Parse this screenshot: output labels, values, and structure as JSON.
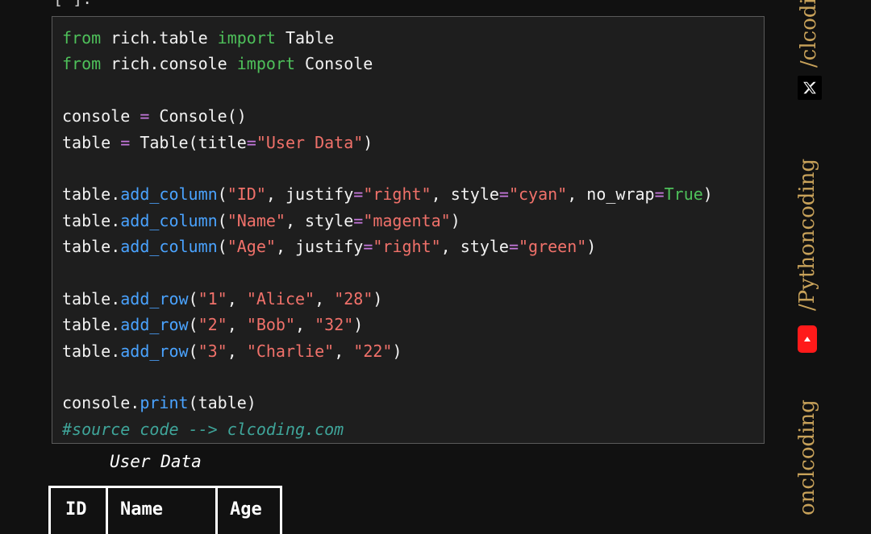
{
  "cell": {
    "prompt": "[*]:"
  },
  "code_lines": [
    [
      {
        "t": "kw",
        "v": "from"
      },
      {
        "t": "",
        "v": " rich.table "
      },
      {
        "t": "kw",
        "v": "import"
      },
      {
        "t": "",
        "v": " Table"
      }
    ],
    [
      {
        "t": "kw",
        "v": "from"
      },
      {
        "t": "",
        "v": " rich.console "
      },
      {
        "t": "kw",
        "v": "import"
      },
      {
        "t": "",
        "v": " Console"
      }
    ],
    [],
    [
      {
        "t": "",
        "v": "console "
      },
      {
        "t": "op",
        "v": "="
      },
      {
        "t": "",
        "v": " Console()"
      }
    ],
    [
      {
        "t": "",
        "v": "table "
      },
      {
        "t": "op",
        "v": "="
      },
      {
        "t": "",
        "v": " Table(title"
      },
      {
        "t": "op",
        "v": "="
      },
      {
        "t": "str",
        "v": "\"User Data\""
      },
      {
        "t": "",
        "v": ")"
      }
    ],
    [],
    [
      {
        "t": "",
        "v": "table."
      },
      {
        "t": "fn",
        "v": "add_column"
      },
      {
        "t": "",
        "v": "("
      },
      {
        "t": "str",
        "v": "\"ID\""
      },
      {
        "t": "",
        "v": ", justify"
      },
      {
        "t": "op",
        "v": "="
      },
      {
        "t": "str",
        "v": "\"right\""
      },
      {
        "t": "",
        "v": ", style"
      },
      {
        "t": "op",
        "v": "="
      },
      {
        "t": "str",
        "v": "\"cyan\""
      },
      {
        "t": "",
        "v": ", no_wrap"
      },
      {
        "t": "op",
        "v": "="
      },
      {
        "t": "bool",
        "v": "True"
      },
      {
        "t": "",
        "v": ")"
      }
    ],
    [
      {
        "t": "",
        "v": "table."
      },
      {
        "t": "fn",
        "v": "add_column"
      },
      {
        "t": "",
        "v": "("
      },
      {
        "t": "str",
        "v": "\"Name\""
      },
      {
        "t": "",
        "v": ", style"
      },
      {
        "t": "op",
        "v": "="
      },
      {
        "t": "str",
        "v": "\"magenta\""
      },
      {
        "t": "",
        "v": ")"
      }
    ],
    [
      {
        "t": "",
        "v": "table."
      },
      {
        "t": "fn",
        "v": "add_column"
      },
      {
        "t": "",
        "v": "("
      },
      {
        "t": "str",
        "v": "\"Age\""
      },
      {
        "t": "",
        "v": ", justify"
      },
      {
        "t": "op",
        "v": "="
      },
      {
        "t": "str",
        "v": "\"right\""
      },
      {
        "t": "",
        "v": ", style"
      },
      {
        "t": "op",
        "v": "="
      },
      {
        "t": "str",
        "v": "\"green\""
      },
      {
        "t": "",
        "v": ")"
      }
    ],
    [],
    [
      {
        "t": "",
        "v": "table."
      },
      {
        "t": "fn",
        "v": "add_row"
      },
      {
        "t": "",
        "v": "("
      },
      {
        "t": "str",
        "v": "\"1\""
      },
      {
        "t": "",
        "v": ", "
      },
      {
        "t": "str",
        "v": "\"Alice\""
      },
      {
        "t": "",
        "v": ", "
      },
      {
        "t": "str",
        "v": "\"28\""
      },
      {
        "t": "",
        "v": ")"
      }
    ],
    [
      {
        "t": "",
        "v": "table."
      },
      {
        "t": "fn",
        "v": "add_row"
      },
      {
        "t": "",
        "v": "("
      },
      {
        "t": "str",
        "v": "\"2\""
      },
      {
        "t": "",
        "v": ", "
      },
      {
        "t": "str",
        "v": "\"Bob\""
      },
      {
        "t": "",
        "v": ", "
      },
      {
        "t": "str",
        "v": "\"32\""
      },
      {
        "t": "",
        "v": ")"
      }
    ],
    [
      {
        "t": "",
        "v": "table."
      },
      {
        "t": "fn",
        "v": "add_row"
      },
      {
        "t": "",
        "v": "("
      },
      {
        "t": "str",
        "v": "\"3\""
      },
      {
        "t": "",
        "v": ", "
      },
      {
        "t": "str",
        "v": "\"Charlie\""
      },
      {
        "t": "",
        "v": ", "
      },
      {
        "t": "str",
        "v": "\"22\""
      },
      {
        "t": "",
        "v": ")"
      }
    ],
    [],
    [
      {
        "t": "",
        "v": "console."
      },
      {
        "t": "fn",
        "v": "print"
      },
      {
        "t": "",
        "v": "(table)"
      }
    ],
    [
      {
        "t": "cmt",
        "v": "#source code --> clcoding.com"
      }
    ]
  ],
  "output": {
    "title": "User Data",
    "headers": [
      "ID",
      "Name",
      "Age"
    ]
  },
  "sidebar": {
    "top_handle": "/clcodi",
    "x_icon": "x-logo-icon",
    "middle_handle": "/Pythoncoding",
    "yt_icon": "youtube-icon",
    "bottom_handle": "onclcoding"
  },
  "colors": {
    "keyword": "#4ec05a",
    "operator": "#c678dd",
    "string": "#f0716a",
    "function": "#4aa3ff",
    "comment": "#3fa59a",
    "sidebar_text": "#c8a25a",
    "youtube": "#ff1a1a"
  }
}
